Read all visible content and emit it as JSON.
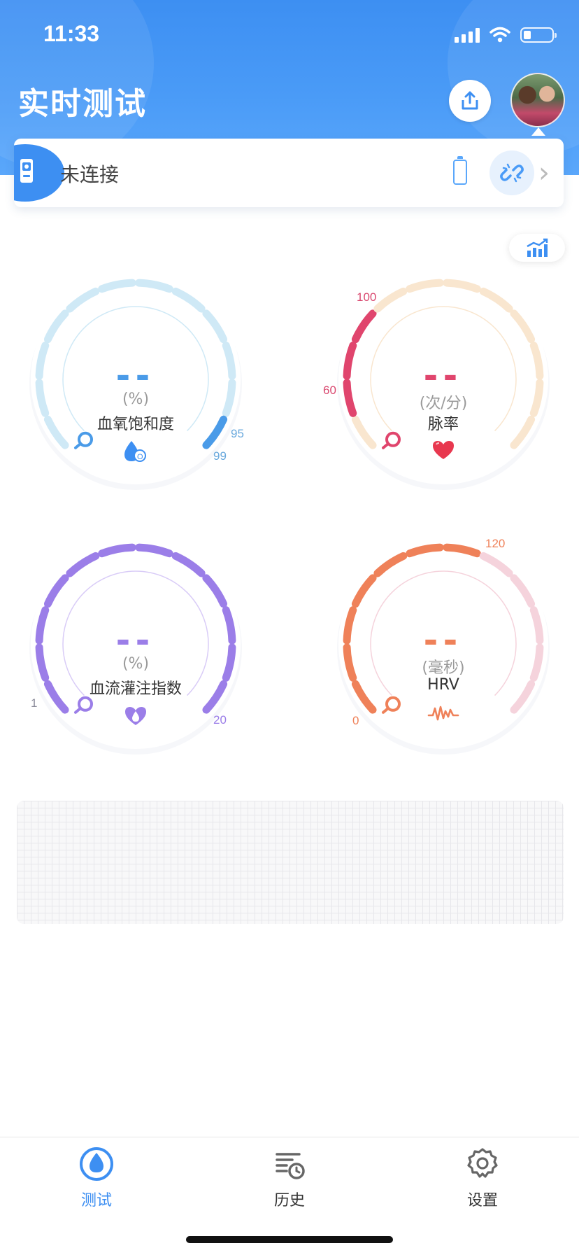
{
  "status_bar": {
    "time": "11:33"
  },
  "header": {
    "title": "实时测试"
  },
  "device": {
    "status": "未连接"
  },
  "gauges": {
    "spo2": {
      "value": "--",
      "unit": "(%)",
      "label": "血氧饱和度",
      "tick_a": "95",
      "tick_b": "99",
      "color": "#4a9be8",
      "track": "#cfe9f6"
    },
    "pulse": {
      "value": "--",
      "unit": "(次/分)",
      "label": "脉率",
      "tick_a": "100",
      "tick_b": "60",
      "color": "#e0456d",
      "track": "#f9e6cf"
    },
    "pi": {
      "value": "--",
      "unit": "(%)",
      "label": "血流灌注指数",
      "tick_a": "1",
      "tick_b": "20",
      "color": "#9b7ee8",
      "track": "#d9ccf7"
    },
    "hrv": {
      "value": "--",
      "unit": "(毫秒)",
      "label": "HRV",
      "tick_a": "120",
      "tick_b": "0",
      "color": "#ef8159",
      "track": "#f5d3dc"
    }
  },
  "tabs": [
    {
      "label": "测试",
      "active": true
    },
    {
      "label": "历史",
      "active": false
    },
    {
      "label": "设置",
      "active": false
    }
  ]
}
